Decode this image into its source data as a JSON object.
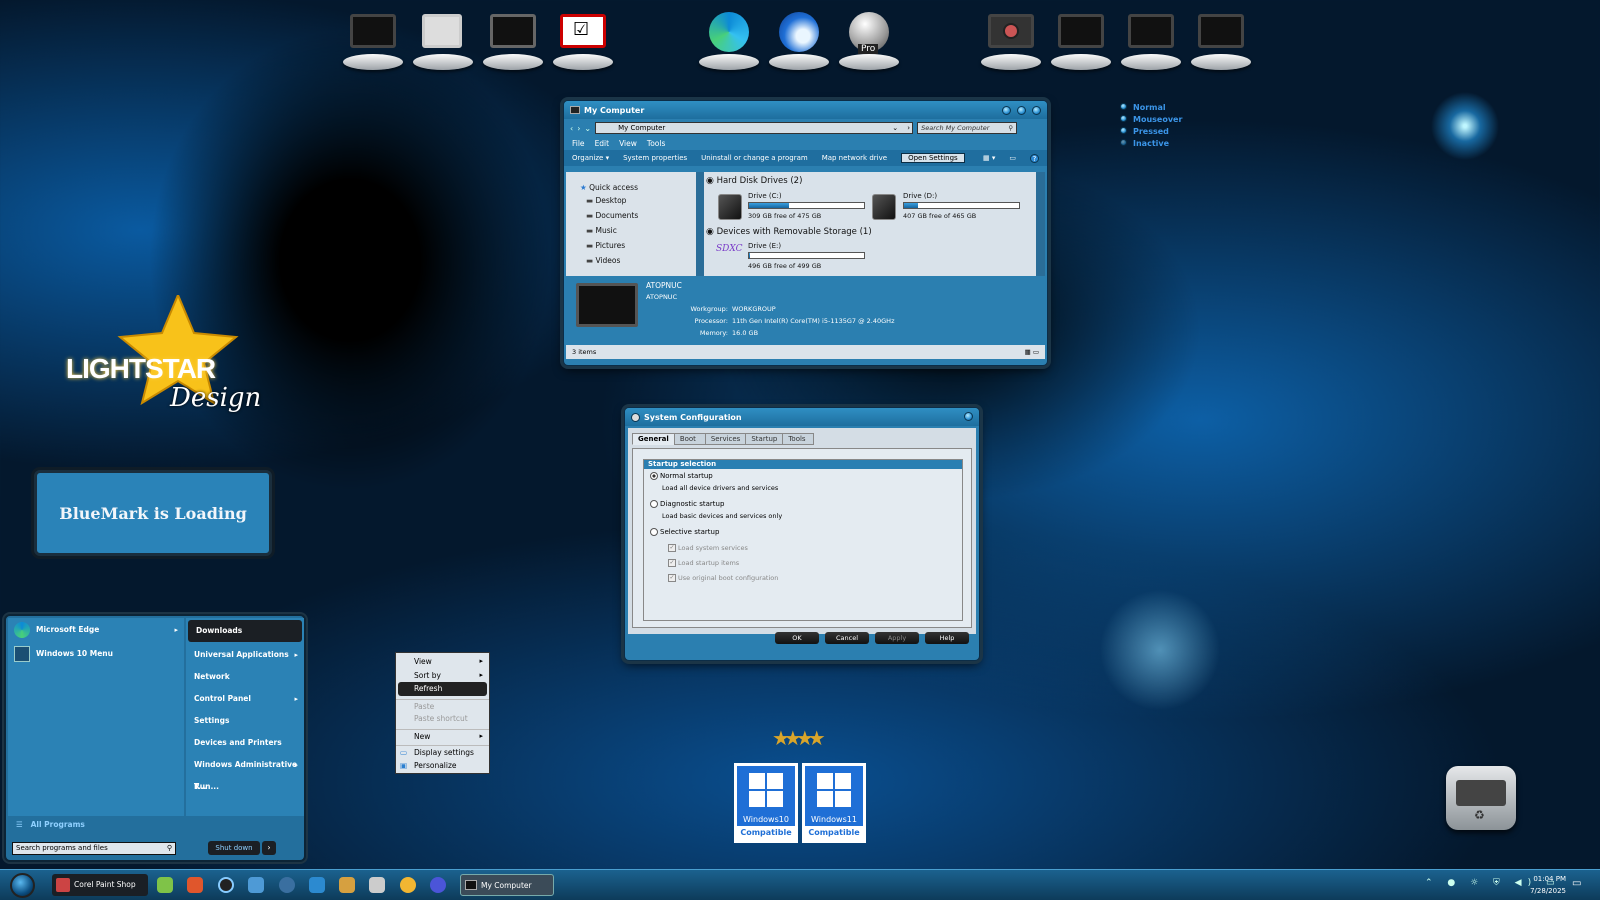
{
  "dock": {
    "items": [
      {
        "name": "computer-dock-icon"
      },
      {
        "name": "control-panel-dock-icon"
      },
      {
        "name": "network-dock-icon"
      },
      {
        "name": "checklist-dock-icon"
      },
      {
        "name": "edge-dock-icon"
      },
      {
        "name": "thunderbird-dock-icon"
      },
      {
        "name": "paint-shop-pro-dock-icon",
        "label": "Pro"
      },
      {
        "name": "camera-dock-icon"
      },
      {
        "name": "monitor-dock-icon"
      },
      {
        "name": "monitor-dock-icon"
      },
      {
        "name": "monitor-dock-icon"
      }
    ]
  },
  "legend": {
    "items": [
      "Normal",
      "Mouseover",
      "Pressed",
      "Inactive"
    ],
    "colors": [
      "#2f8de4",
      "#2f8de4",
      "#2f8de4",
      "#2f8de4"
    ]
  },
  "logo": {
    "line1": "LIGHTSTAR",
    "line2": "Design"
  },
  "loading": {
    "text": "BlueMark is Loading"
  },
  "explorer": {
    "title": "My Computer",
    "address": "My Computer",
    "search_placeholder": "Search My Computer",
    "menu": [
      "File",
      "Edit",
      "View",
      "Tools"
    ],
    "toolbar": [
      "Organize ▾",
      "System properties",
      "Uninstall or change a program",
      "Map network drive",
      "Open Settings"
    ],
    "nav": {
      "header": "Quick access",
      "items": [
        "Desktop",
        "Documents",
        "Music",
        "Pictures",
        "Videos"
      ]
    },
    "groups": [
      {
        "title": "Hard Disk Drives (2)"
      },
      {
        "title": "Devices with Removable Storage (1)"
      }
    ],
    "drives": [
      {
        "name": "Drive (C:)",
        "info": "309 GB free of 475 GB",
        "fill": 0.35
      },
      {
        "name": "Drive (D:)",
        "info": "407 GB free of 465 GB",
        "fill": 0.12
      },
      {
        "name": "Drive (E:)",
        "info": "496 GB free of 499 GB",
        "fill": 0.01,
        "tag": "SDXC"
      }
    ],
    "details": {
      "name": "ATOPNUC",
      "sub": "ATOPNUC",
      "rows": [
        {
          "k": "Workgroup:",
          "v": "WORKGROUP"
        },
        {
          "k": "Processor:",
          "v": "11th Gen Intel(R) Core(TM) i5-1135G7 @ 2.40GHz"
        },
        {
          "k": "Memory:",
          "v": "16.0 GB"
        }
      ]
    },
    "status": "3 items"
  },
  "sysconfig": {
    "title": "System Configuration",
    "tabs": [
      "General",
      "Boot",
      "Services",
      "Startup",
      "Tools"
    ],
    "group": "Startup selection",
    "normal": "Normal startup",
    "normal_desc": "Load all device drivers and services",
    "diag": "Diagnostic startup",
    "diag_desc": "Load basic devices and services only",
    "selective": "Selective startup",
    "checks": [
      "Load system services",
      "Load startup items",
      "Use original boot configuration"
    ],
    "buttons": [
      "OK",
      "Cancel",
      "Apply",
      "Help"
    ]
  },
  "context_menu": {
    "items": [
      "View",
      "Sort by",
      "Refresh",
      "Paste",
      "Paste shortcut",
      "New",
      "Display settings",
      "Personalize"
    ]
  },
  "start_menu": {
    "left": [
      "Microsoft Edge",
      "Windows 10 Menu"
    ],
    "right": [
      "Downloads",
      "Universal Applications",
      "Network",
      "Control Panel",
      "Settings",
      "Devices and Printers",
      "Windows Administrative T...",
      "Run..."
    ],
    "all_programs": "All Programs",
    "search_placeholder": "Search programs and files",
    "shutdown": "Shut down"
  },
  "badges": [
    {
      "line1": "Windows10",
      "line2": "Compatible"
    },
    {
      "line1": "Windows11",
      "line2": "Compatible"
    }
  ],
  "taskbar": {
    "tasks": [
      "Corel Paint Shop P...",
      "My Computer"
    ],
    "time": "01:04 PM",
    "date": "7/28/2025"
  }
}
